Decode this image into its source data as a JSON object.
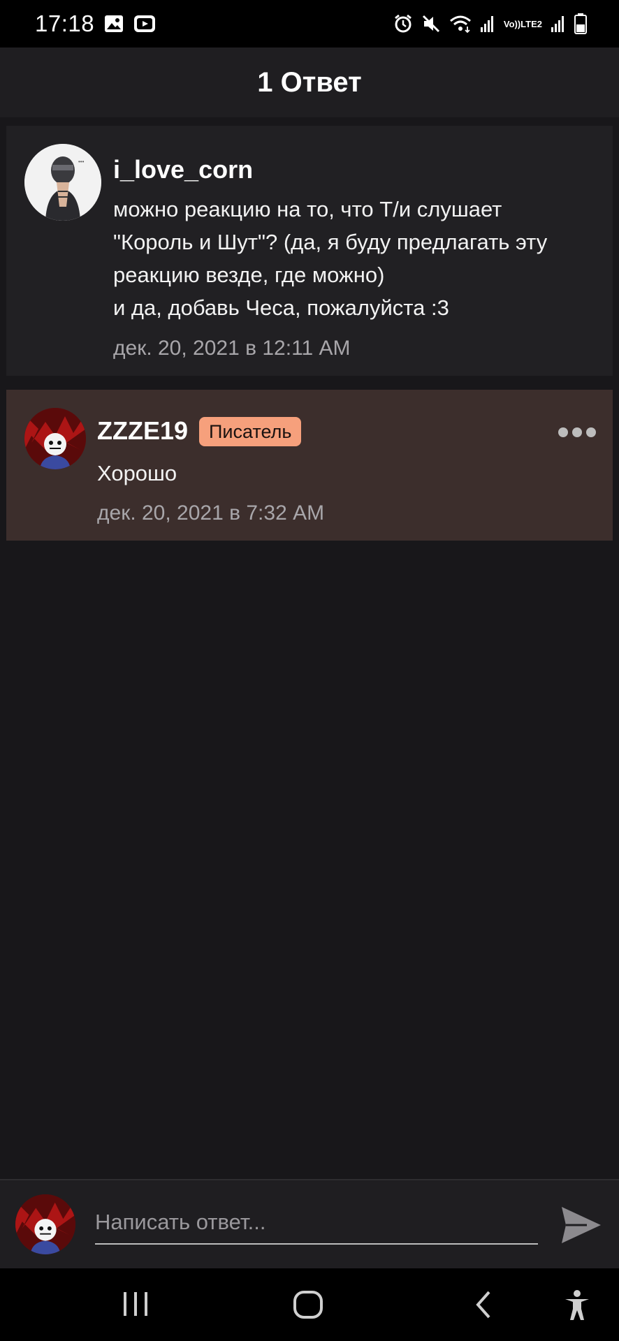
{
  "status_bar": {
    "time": "17:18",
    "left_icons": [
      "image-icon",
      "youtube-icon"
    ],
    "right_icons": [
      "alarm-icon",
      "mute-icon",
      "wifi-icon",
      "signal-icon",
      "volte-icon",
      "signal-icon",
      "battery-icon"
    ],
    "volte_line1": "Vo))",
    "volte_line2": "LTE2"
  },
  "header": {
    "title": "1 Ответ"
  },
  "parent_comment": {
    "author": "i_love_corn",
    "lines": [
      "можно реакцию на то, что Т/и слушает",
      "\"Король и Шут\"? (да, я буду предлагать эту",
      "реакцию везде, где можно)",
      "и да, добавь Чеса, пожалуйста :3"
    ],
    "timestamp": "дек. 20, 2021 в 12:11 AM"
  },
  "reply_comment": {
    "author": "ZZZE19",
    "badge": "Писатель",
    "text": "Хорошо",
    "timestamp": "дек. 20, 2021 в 7:32 AM"
  },
  "reply_bar": {
    "placeholder": "Написать ответ..."
  },
  "colors": {
    "background": "#18171a",
    "reply_highlight": "#3c2e2c",
    "badge": "#f6a07c"
  },
  "nav_bar": {
    "buttons": [
      "recents-icon",
      "home-icon",
      "back-icon",
      "accessibility-icon"
    ]
  }
}
